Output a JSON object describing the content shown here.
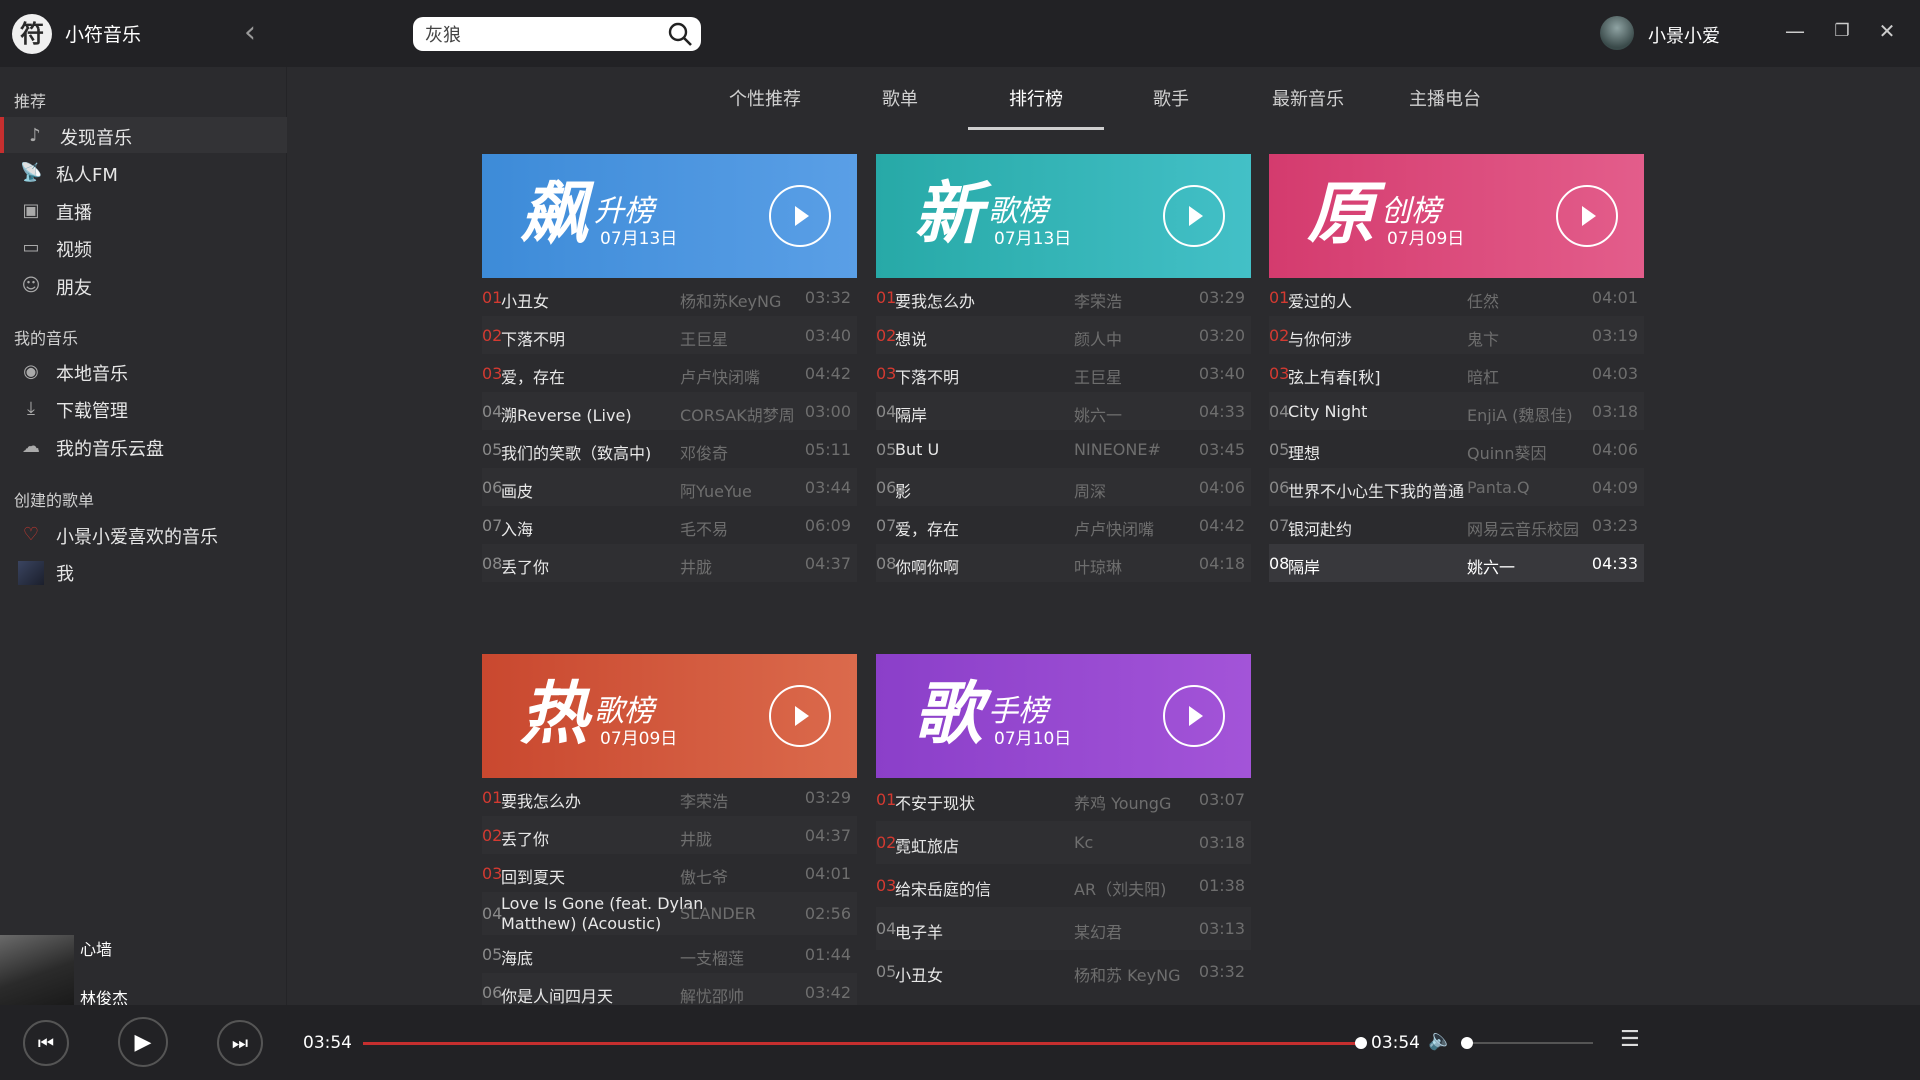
{
  "app": {
    "logo_char": "符",
    "name": "小符音乐",
    "back": "‹",
    "search_value": "灰狼",
    "user": "小景小爱",
    "win_min": "—",
    "win_max": "❐",
    "win_close": "✕"
  },
  "sidebar": {
    "sec1": "推荐",
    "sec2": "我的音乐",
    "sec3": "创建的歌单",
    "nav": [
      {
        "icon": "♪",
        "label": "发现音乐"
      },
      {
        "icon": "📡",
        "label": "私人FM"
      },
      {
        "icon": "▣",
        "label": "直播"
      },
      {
        "icon": "▭",
        "label": "视频"
      },
      {
        "icon": "☺",
        "label": "朋友"
      },
      {
        "icon": "◉",
        "label": "本地音乐"
      },
      {
        "icon": "⤓",
        "label": "下载管理"
      },
      {
        "icon": "☁",
        "label": "我的音乐云盘"
      },
      {
        "icon": "♡",
        "label": "小景小爱喜欢的音乐"
      },
      {
        "icon": "",
        "label": "我"
      }
    ]
  },
  "tabs": [
    "个性推荐",
    "歌单",
    "排行榜",
    "歌手",
    "最新音乐",
    "主播电台"
  ],
  "boards": [
    {
      "big": "飙",
      "sub": "升榜",
      "date": "07月13日",
      "color1": "#3d8bd8",
      "color2": "#5a9fe6",
      "rows": [
        {
          "rk": "01",
          "nm": "小丑女",
          "ar": "杨和苏KeyNG",
          "du": "03:32"
        },
        {
          "rk": "02",
          "nm": "下落不明",
          "ar": "王巨星",
          "du": "03:40"
        },
        {
          "rk": "03",
          "nm": "爱，存在",
          "ar": "卢卢快闭嘴",
          "du": "04:42"
        },
        {
          "rk": "04",
          "nm": "溯Reverse (Live)",
          "ar": "CORSAK胡梦周",
          "du": "03:00"
        },
        {
          "rk": "05",
          "nm": "我们的笑歌（致高中)",
          "ar": "邓俊奇",
          "du": "05:11"
        },
        {
          "rk": "06",
          "nm": "画皮",
          "ar": "阿YueYue",
          "du": "03:44"
        },
        {
          "rk": "07",
          "nm": "入海",
          "ar": "毛不易",
          "du": "06:09"
        },
        {
          "rk": "08",
          "nm": "丢了你",
          "ar": "井胧",
          "du": "04:37"
        }
      ]
    },
    {
      "big": "新",
      "sub": "歌榜",
      "date": "07月13日",
      "color1": "#27a9a7",
      "color2": "#43c0c7",
      "rows": [
        {
          "rk": "01",
          "nm": "要我怎么办",
          "ar": "李荣浩",
          "du": "03:29"
        },
        {
          "rk": "02",
          "nm": "想说",
          "ar": "颜人中",
          "du": "03:20"
        },
        {
          "rk": "03",
          "nm": "下落不明",
          "ar": "王巨星",
          "du": "03:40"
        },
        {
          "rk": "04",
          "nm": "隔岸",
          "ar": "姚六一",
          "du": "04:33"
        },
        {
          "rk": "05",
          "nm": "But U",
          "ar": "NINEONE#",
          "du": "03:45"
        },
        {
          "rk": "06",
          "nm": "影",
          "ar": "周深",
          "du": "04:06"
        },
        {
          "rk": "07",
          "nm": "爱，存在",
          "ar": "卢卢快闭嘴",
          "du": "04:42"
        },
        {
          "rk": "08",
          "nm": "你啊你啊",
          "ar": "叶琼琳",
          "du": "04:18"
        }
      ]
    },
    {
      "big": "原",
      "sub": "创榜",
      "date": "07月09日",
      "color1": "#d43b6e",
      "color2": "#e35d8b",
      "rows": [
        {
          "rk": "01",
          "nm": "爱过的人",
          "ar": "任然",
          "du": "04:01"
        },
        {
          "rk": "02",
          "nm": "与你何涉",
          "ar": "鬼卞",
          "du": "03:19"
        },
        {
          "rk": "03",
          "nm": "弦上有春[秋]",
          "ar": "暗杠",
          "du": "04:03"
        },
        {
          "rk": "04",
          "nm": "City Night",
          "ar": "EnjiA (魏恩佳)",
          "du": "03:18"
        },
        {
          "rk": "05",
          "nm": "理想",
          "ar": "Quinn葵因",
          "du": "04:06"
        },
        {
          "rk": "06",
          "nm": "世界不小心生下我的普通",
          "ar": "Panta.Q",
          "du": "04:09"
        },
        {
          "rk": "07",
          "nm": "银河赴约",
          "ar": "网易云音乐校园",
          "du": "03:23"
        },
        {
          "rk": "08",
          "nm": "隔岸",
          "ar": "姚六一",
          "du": "04:33"
        }
      ]
    },
    {
      "big": "热",
      "sub": "歌榜",
      "date": "07月09日",
      "color1": "#c9482f",
      "color2": "#db6a4c",
      "rows": [
        {
          "rk": "01",
          "nm": "要我怎么办",
          "ar": "李荣浩",
          "du": "03:29"
        },
        {
          "rk": "02",
          "nm": "丢了你",
          "ar": "井胧",
          "du": "04:37"
        },
        {
          "rk": "03",
          "nm": "回到夏天",
          "ar": "傲七爷",
          "du": "04:01"
        },
        {
          "rk": "04",
          "nm": "Love Is Gone (feat. Dylan Matthew) (Acoustic)",
          "ar": "SLANDER",
          "du": "02:56"
        },
        {
          "rk": "05",
          "nm": "海底",
          "ar": "一支榴莲",
          "du": "01:44"
        },
        {
          "rk": "06",
          "nm": "你是人间四月天",
          "ar": "解忧邵帅",
          "du": "03:42"
        }
      ]
    },
    {
      "big": "歌",
      "sub": "手榜",
      "date": "07月10日",
      "color1": "#8b3fc9",
      "color2": "#a354d8",
      "rows": [
        {
          "rk": "01",
          "nm": "不安于现状",
          "ar": "养鸡 YoungG",
          "du": "03:07"
        },
        {
          "rk": "02",
          "nm": "霓虹旅店",
          "ar": "Kc",
          "du": "03:18"
        },
        {
          "rk": "03",
          "nm": "给宋岳庭的信",
          "ar": "AR（刘夫阳)",
          "du": "01:38"
        },
        {
          "rk": "04",
          "nm": "电子羊",
          "ar": "某幻君",
          "du": "03:13"
        },
        {
          "rk": "05",
          "nm": "小丑女",
          "ar": "杨和苏 KeyNG",
          "du": "03:32"
        }
      ]
    }
  ],
  "now_playing": {
    "title": "心墙",
    "artist": "林俊杰"
  },
  "player": {
    "prev": "⏮",
    "play": "▶",
    "next": "⏭",
    "current": "03:54",
    "total": "03:54",
    "progress": 1.0,
    "volume": 0.0,
    "accent": "#c62f2f"
  }
}
